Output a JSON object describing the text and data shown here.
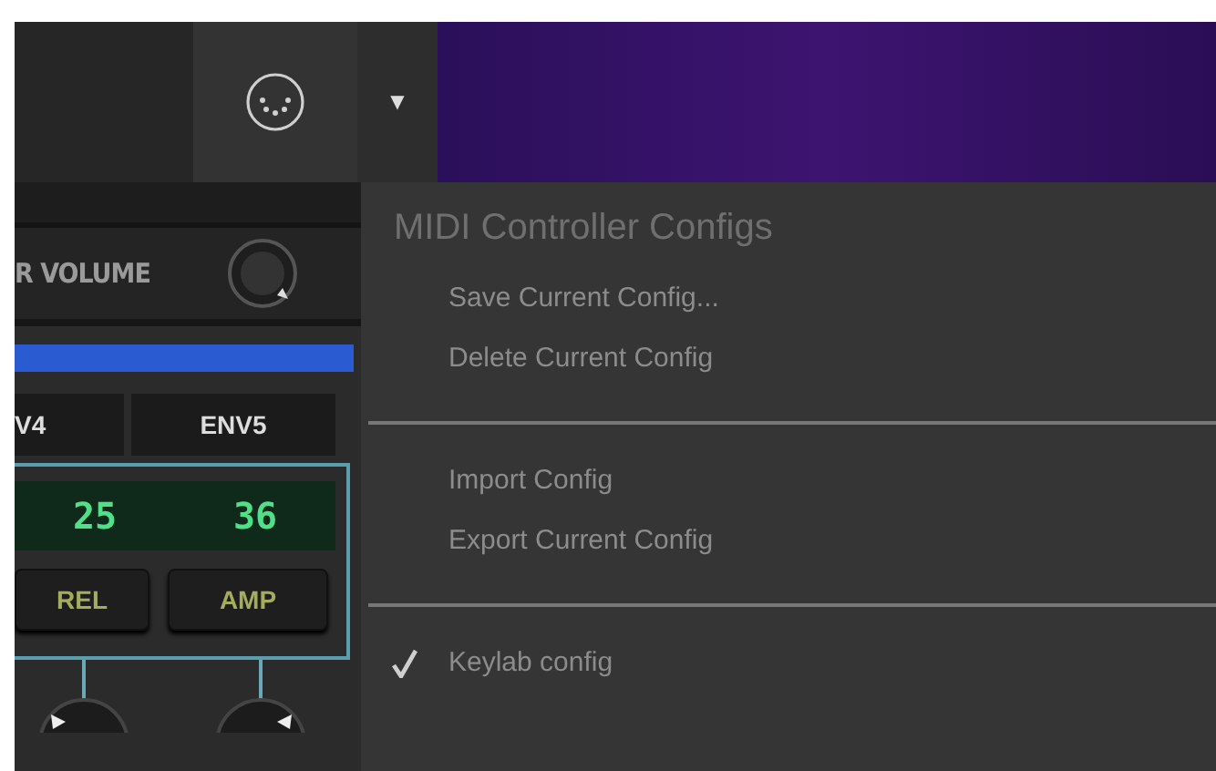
{
  "toolbar": {
    "dropdown_glyph": "▼"
  },
  "synth": {
    "volume_label": "R VOLUME",
    "tabs": [
      "V4",
      "ENV5"
    ],
    "readouts": [
      "25",
      "36"
    ],
    "buttons": [
      "REL",
      "AMP"
    ]
  },
  "menu": {
    "title": "MIDI Controller Configs",
    "groups": [
      [
        {
          "label": "Save Current Config...",
          "checked": false
        },
        {
          "label": "Delete Current Config",
          "checked": false
        }
      ],
      [
        {
          "label": "Import Config",
          "checked": false
        },
        {
          "label": "Export Current Config",
          "checked": false
        }
      ],
      [
        {
          "label": "Keylab config",
          "checked": true
        }
      ]
    ]
  }
}
